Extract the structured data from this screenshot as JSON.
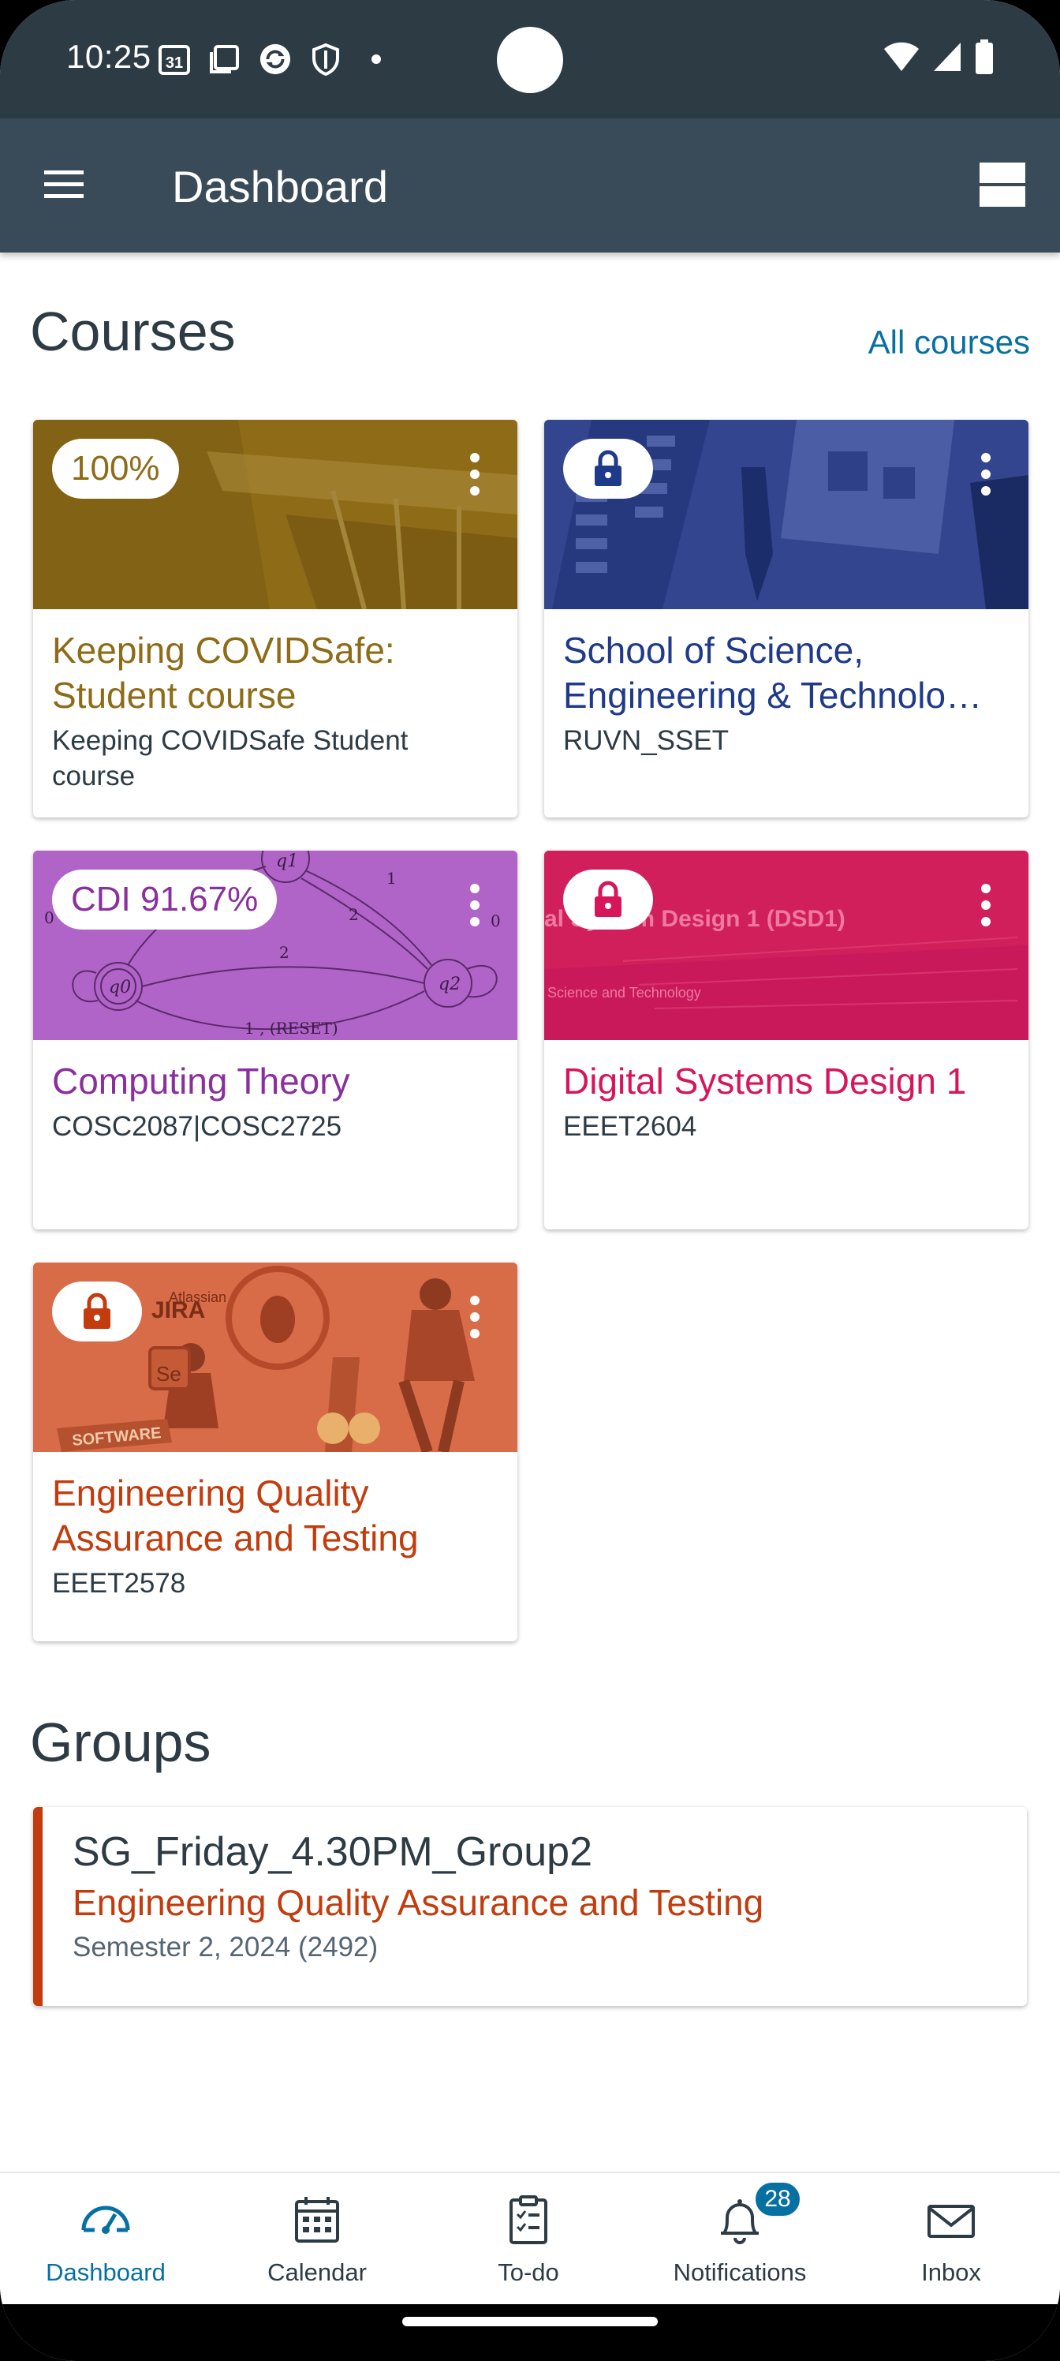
{
  "status_bar": {
    "time": "10:25",
    "calendar_day": "31",
    "icons_left": [
      "calendar-icon",
      "screen-icon",
      "sync-icon",
      "shield-icon",
      "dot-icon"
    ],
    "icons_right": [
      "wifi-icon",
      "signal-icon",
      "battery-icon"
    ]
  },
  "app_bar": {
    "title": "Dashboard"
  },
  "courses_section": {
    "title": "Courses",
    "all_courses_link": "All courses",
    "courses": [
      {
        "name": "Keeping COVIDSafe: Student course",
        "code": "Keeping COVIDSafe Student course",
        "grade": "100%",
        "locked": false,
        "color": "#8e6c17"
      },
      {
        "name": "School of Science, Engineering & Technolo…",
        "code": "RUVN_SSET",
        "grade": "",
        "locked": true,
        "color": "#1f3a8a"
      },
      {
        "name": "Computing Theory",
        "code": "COSC2087|COSC2725",
        "grade": "CDI 91.67%",
        "locked": false,
        "color": "#8a2f9e"
      },
      {
        "name": "Digital Systems Design 1",
        "code": "EEET2604",
        "grade": "",
        "locked": true,
        "color": "#d7155b",
        "banner_text": "al System Design 1 (DSD1)",
        "banner_subtext": "Science and Technology"
      },
      {
        "name": "Engineering Quality Assurance and Testing",
        "code": "EEET2578",
        "grade": "",
        "locked": true,
        "color": "#c23c0d",
        "banner_text_1": "JIRA",
        "banner_text_2": "SOFTWARE",
        "banner_text_3": "Atlassian",
        "banner_text_4": "Se"
      }
    ]
  },
  "groups_section": {
    "title": "Groups",
    "groups": [
      {
        "name": "SG_Friday_4.30PM_Group2",
        "course": "Engineering Quality Assurance and Testing",
        "term": "Semester 2, 2024 (2492)"
      }
    ]
  },
  "bottom_nav": {
    "items": [
      {
        "label": "Dashboard",
        "icon": "dashboard-icon",
        "active": true
      },
      {
        "label": "Calendar",
        "icon": "calendar-icon",
        "active": false
      },
      {
        "label": "To-do",
        "icon": "todo-icon",
        "active": false
      },
      {
        "label": "Notifications",
        "icon": "bell-icon",
        "active": false,
        "badge": "28"
      },
      {
        "label": "Inbox",
        "icon": "inbox-icon",
        "active": false
      }
    ]
  },
  "computing_theory_diagram": {
    "states": [
      "q0",
      "q1",
      "q2"
    ],
    "edge_labels": [
      "1",
      "2",
      "2",
      "0",
      "0",
      "1 , (RESET)"
    ]
  },
  "colors": {
    "app_bar": "#394b58",
    "status_bar": "#2d3b45",
    "link": "#0770a3",
    "text": "#2d3b45"
  }
}
